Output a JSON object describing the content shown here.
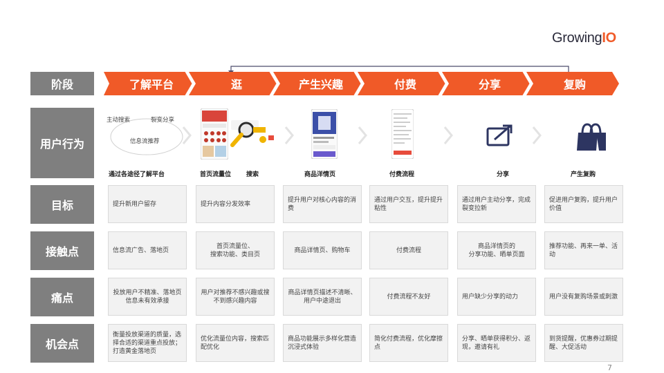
{
  "logo": {
    "growing": "Growing",
    "io": "IO"
  },
  "rows": {
    "stage": "阶段",
    "behavior": "用户行为",
    "goal": "目标",
    "touchpoint": "接触点",
    "pain": "痛点",
    "opportunity": "机会点"
  },
  "stages": [
    "了解平台",
    "逛",
    "产生兴趣",
    "付费",
    "分享",
    "复购"
  ],
  "behavior": {
    "bubble": {
      "search": "主动搜索",
      "share": "裂变分享",
      "feed": "信息流推荐"
    },
    "captions": [
      "通过各途径了解平台",
      "首页流量位",
      "搜索",
      "商品洋情页",
      "付费流程",
      "分享",
      "产生复购"
    ]
  },
  "goals": [
    "提升新用户留存",
    "提升内容分发效率",
    "提升用户对核心内容的消费",
    "通过用户交互，提升提升粘性",
    "通过用户主动分享，完成裂变拉新",
    "促进用户复购，提升用户价值"
  ],
  "touchpoints": [
    "信息流广告、落地页",
    "首页流量位、\n搜索功能、类目页",
    "商品详情页、购物车",
    "付费流程",
    "商品洋情页的\n分享功能、晒单页面",
    "推荐功能、再来一单、活动"
  ],
  "pains": [
    "投放用户不精准、落地页信息未有效承接",
    "用户对推荐不感兴趣或搜不到感兴趣内容",
    "商品详情页描述不清晰、用户中途退出",
    "付费流程不友好",
    "用户缺少分享的动力",
    "用户没有复购场景或刺激"
  ],
  "opportunities": [
    "衡量投放渠道的质量，选择合适的渠道重点投放；打造黄金落地页",
    "优化流量位内容，搜索匹配优化",
    "商品功能展示多样化营造沉浸式体验",
    "简化付费流程，优化摩擦点",
    "分享、晒单获得积分、返现，邀请有礼",
    "到货提醒，优惠券过期提醒、大促活动"
  ],
  "page_number": "7",
  "colors": {
    "accent": "#f05a28",
    "label_bg": "#7f7f7f",
    "cell_bg": "#f2f2f2"
  }
}
